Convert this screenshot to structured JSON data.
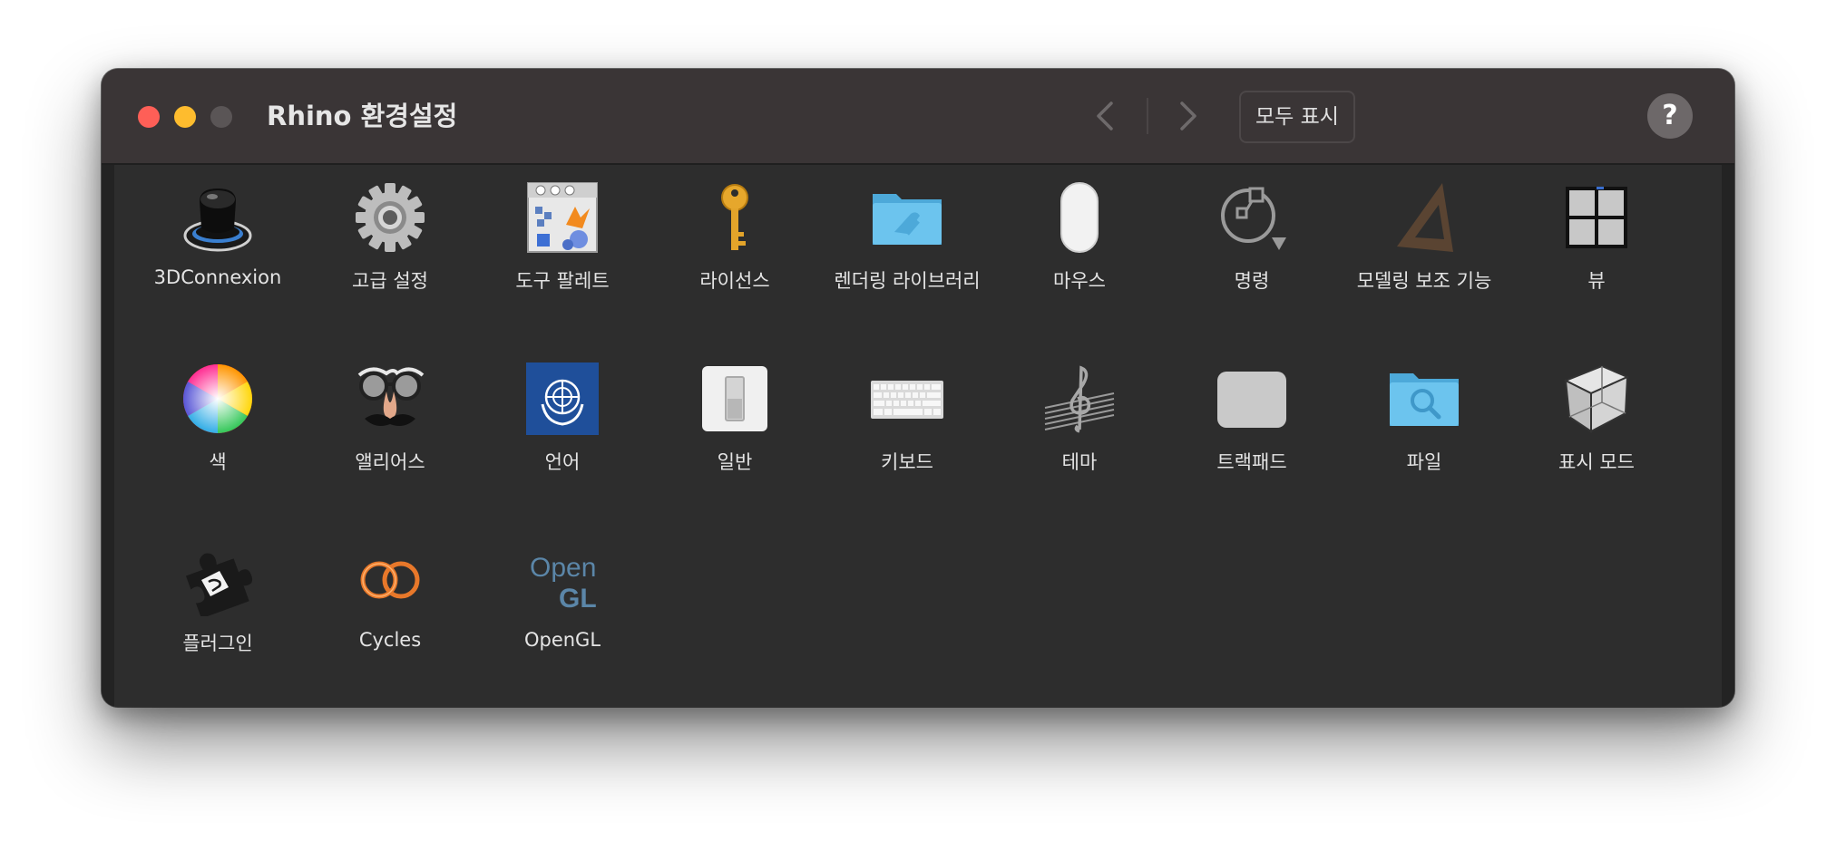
{
  "window": {
    "title": "Rhino 환경설정",
    "show_all_label": "모두 표시",
    "help_label": "?"
  },
  "icons": [
    {
      "label": "3DConnexion",
      "icon": "3dconnexion-icon"
    },
    {
      "label": "고급 설정",
      "icon": "gear-icon"
    },
    {
      "label": "도구 팔레트",
      "icon": "tool-palette-icon"
    },
    {
      "label": "라이선스",
      "icon": "key-icon"
    },
    {
      "label": "렌더링 라이브러리",
      "icon": "folder-icon"
    },
    {
      "label": "마우스",
      "icon": "mouse-icon"
    },
    {
      "label": "명령",
      "icon": "command-icon"
    },
    {
      "label": "모델링 보조 기능",
      "icon": "set-square-icon"
    },
    {
      "label": "뷰",
      "icon": "viewports-icon"
    },
    {
      "label": "색",
      "icon": "color-wheel-icon"
    },
    {
      "label": "앨리어스",
      "icon": "disguise-glasses-icon"
    },
    {
      "label": "언어",
      "icon": "un-flag-icon"
    },
    {
      "label": "일반",
      "icon": "switch-icon"
    },
    {
      "label": "키보드",
      "icon": "keyboard-icon"
    },
    {
      "label": "테마",
      "icon": "music-staff-icon"
    },
    {
      "label": "트랙패드",
      "icon": "trackpad-icon"
    },
    {
      "label": "파일",
      "icon": "search-folder-icon"
    },
    {
      "label": "표시 모드",
      "icon": "cube-icon"
    },
    {
      "label": "플러그인",
      "icon": "puzzle-piece-icon"
    },
    {
      "label": "Cycles",
      "icon": "cycles-rings-icon"
    },
    {
      "label": "OpenGL",
      "icon": "opengl-icon",
      "icon_text_top": "Open",
      "icon_text_bottom": "GL"
    }
  ],
  "colors": {
    "close": "#fe5f57",
    "minimize": "#febc2e",
    "zoom_disabled": "#5a5556",
    "folder_blue": "#6cc4ee",
    "opengl_blue": "#5b86a8"
  }
}
